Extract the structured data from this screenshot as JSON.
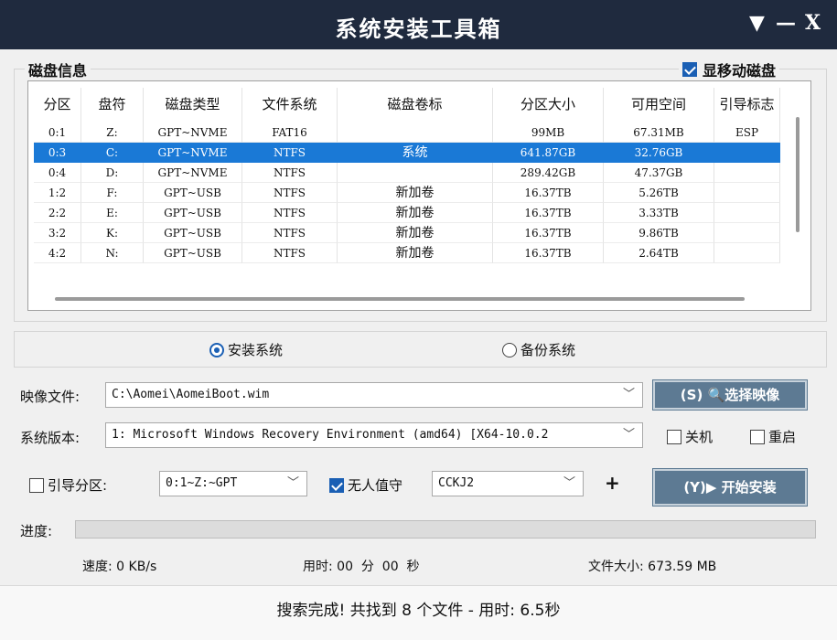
{
  "window": {
    "title": "系统安装工具箱",
    "btn_menu": "▼",
    "btn_min": "—",
    "btn_close": "X"
  },
  "disk": {
    "group_title": "磁盘信息",
    "show_removable_label": "显移动磁盘",
    "show_removable_checked": true,
    "columns": [
      "分区",
      "盘符",
      "磁盘类型",
      "文件系统",
      "磁盘卷标",
      "分区大小",
      "可用空间",
      "引导标志"
    ],
    "rows": [
      [
        "0:1",
        "Z:",
        "GPT~NVME",
        "FAT16",
        "",
        "99MB",
        "67.31MB",
        "ESP"
      ],
      [
        "0:3",
        "C:",
        "GPT~NVME",
        "NTFS",
        "系统",
        "641.87GB",
        "32.76GB",
        ""
      ],
      [
        "0:4",
        "D:",
        "GPT~NVME",
        "NTFS",
        "",
        "289.42GB",
        "47.37GB",
        ""
      ],
      [
        "1:2",
        "F:",
        "GPT~USB",
        "NTFS",
        "新加卷",
        "16.37TB",
        "5.26TB",
        ""
      ],
      [
        "2:2",
        "E:",
        "GPT~USB",
        "NTFS",
        "新加卷",
        "16.37TB",
        "3.33TB",
        ""
      ],
      [
        "3:2",
        "K:",
        "GPT~USB",
        "NTFS",
        "新加卷",
        "16.37TB",
        "9.86TB",
        ""
      ],
      [
        "4:2",
        "N:",
        "GPT~USB",
        "NTFS",
        "新加卷",
        "16.37TB",
        "2.64TB",
        ""
      ]
    ],
    "selected_row": 1
  },
  "mode": {
    "install_label": "安装系统",
    "backup_label": "备份系统",
    "selected": "install"
  },
  "image": {
    "label": "映像文件:",
    "value": "C:\\Aomei\\AomeiBoot.wim",
    "button": "(S) 🔍选择映像"
  },
  "version": {
    "label": "系统版本:",
    "value": "1: Microsoft Windows Recovery Environment (amd64) [X64-10.0.2",
    "shutdown_label": "关机",
    "reboot_label": "重启"
  },
  "boot": {
    "label": "引导分区:",
    "value": "0:1~Z:~GPT",
    "unattended_label": "无人值守",
    "unattended_value": "CCKJ2",
    "plus": "+",
    "start_button": "(Y)▶ 开始安装"
  },
  "progress": {
    "label": "进度:",
    "value": 0
  },
  "stats": {
    "speed": "速度: 0 KB/s",
    "time": "用时: 00  分  00  秒",
    "filesize": "文件大小: 673.59 MB"
  },
  "status": "搜索完成! 共找到 8 个文件 - 用时: 6.5秒",
  "colors": {
    "titlebar": "#1f2a3e",
    "selection": "#1a79d6",
    "button": "#5d7a93",
    "checkbox": "#1a5fb4"
  }
}
